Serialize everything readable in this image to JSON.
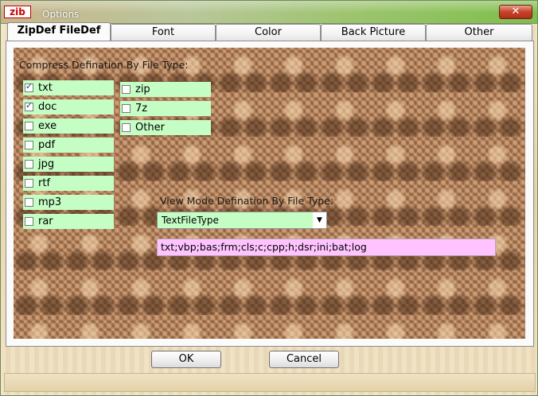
{
  "window": {
    "title": "Options",
    "icon_text": "zib",
    "close_label": "✕"
  },
  "tabs": [
    {
      "label": "ZipDef FileDef",
      "active": true
    },
    {
      "label": "Font",
      "active": false
    },
    {
      "label": "Color",
      "active": false
    },
    {
      "label": "Back Picture",
      "active": false
    },
    {
      "label": "Other",
      "active": false
    }
  ],
  "compress": {
    "heading": "Compress Defination By File Type:",
    "left_items": [
      {
        "label": "txt",
        "checked": true
      },
      {
        "label": "doc",
        "checked": true
      },
      {
        "label": "exe",
        "checked": false
      },
      {
        "label": "pdf",
        "checked": false
      },
      {
        "label": "jpg",
        "checked": false
      },
      {
        "label": "rtf",
        "checked": false
      },
      {
        "label": "mp3",
        "checked": false
      },
      {
        "label": "rar",
        "checked": false
      }
    ],
    "right_items": [
      {
        "label": "zip",
        "checked": false
      },
      {
        "label": "7z",
        "checked": false
      },
      {
        "label": "Other",
        "checked": false
      }
    ]
  },
  "viewmode": {
    "heading": "View Mode Defination By File Type:",
    "selected": "TextFileType",
    "extensions": "txt;vbp;bas;frm;cls;c;cpp;h;dsr;ini;bat;log"
  },
  "buttons": {
    "ok": "OK",
    "cancel": "Cancel"
  },
  "colors": {
    "checkbox_bg": "#c4fec4",
    "extensions_bg": "#ffc4ff",
    "title_green": "#7fbf4b"
  }
}
